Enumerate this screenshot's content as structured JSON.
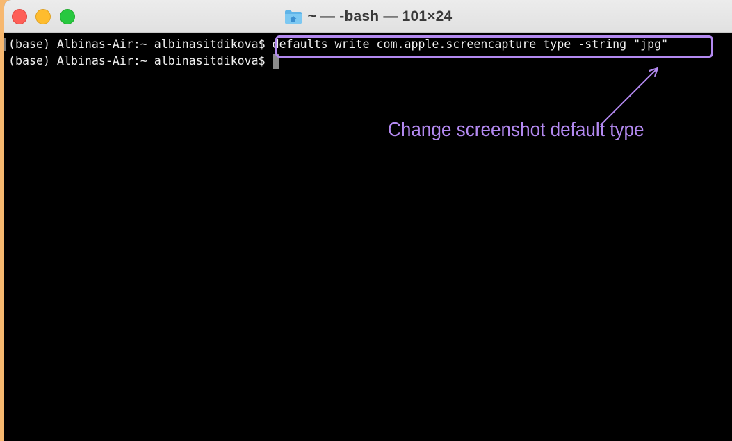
{
  "window": {
    "title": "~ — -bash — 101×24",
    "title_icon": "home-folder-icon"
  },
  "traffic_lights": {
    "close_color": "#fe5f57",
    "minimize_color": "#febc2e",
    "zoom_color": "#28c840"
  },
  "terminal": {
    "lines": [
      {
        "prompt": "(base) Albinas-Air:~ albinasitdikova$ ",
        "command": "defaults write com.apple.screencapture type -string \"jpg\""
      },
      {
        "prompt": "(base) Albinas-Air:~ albinasitdikova$ ",
        "command": ""
      }
    ]
  },
  "annotation": {
    "text": "Change screenshot default type",
    "color": "#b389f0"
  },
  "colors": {
    "background_border": "#f7b86f",
    "terminal_bg": "#000000",
    "terminal_fg": "#f0f0f0"
  }
}
